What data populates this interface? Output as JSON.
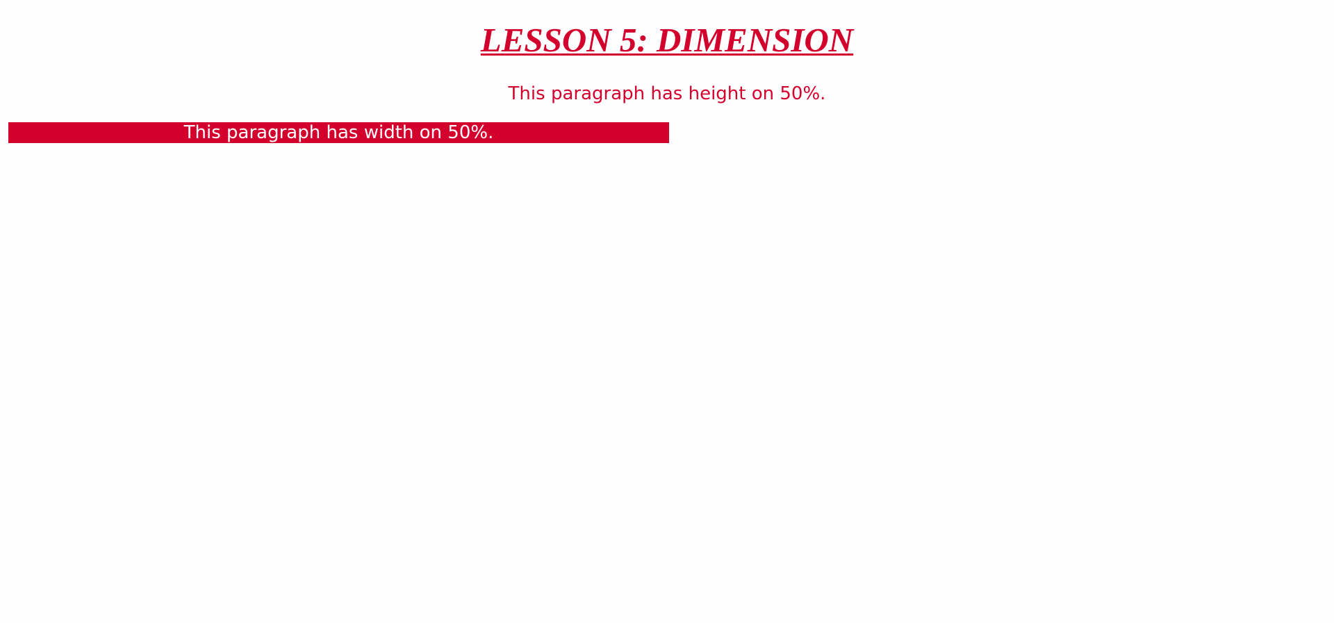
{
  "page": {
    "title": "LESSON 5: DIMENSION",
    "height_paragraph": "This paragraph has height on 50%.",
    "width_paragraph": "This paragraph has width on 50%."
  },
  "colors": {
    "accent": "#d3002d",
    "background": "#fefefe",
    "inverse_text": "#ffffff"
  }
}
